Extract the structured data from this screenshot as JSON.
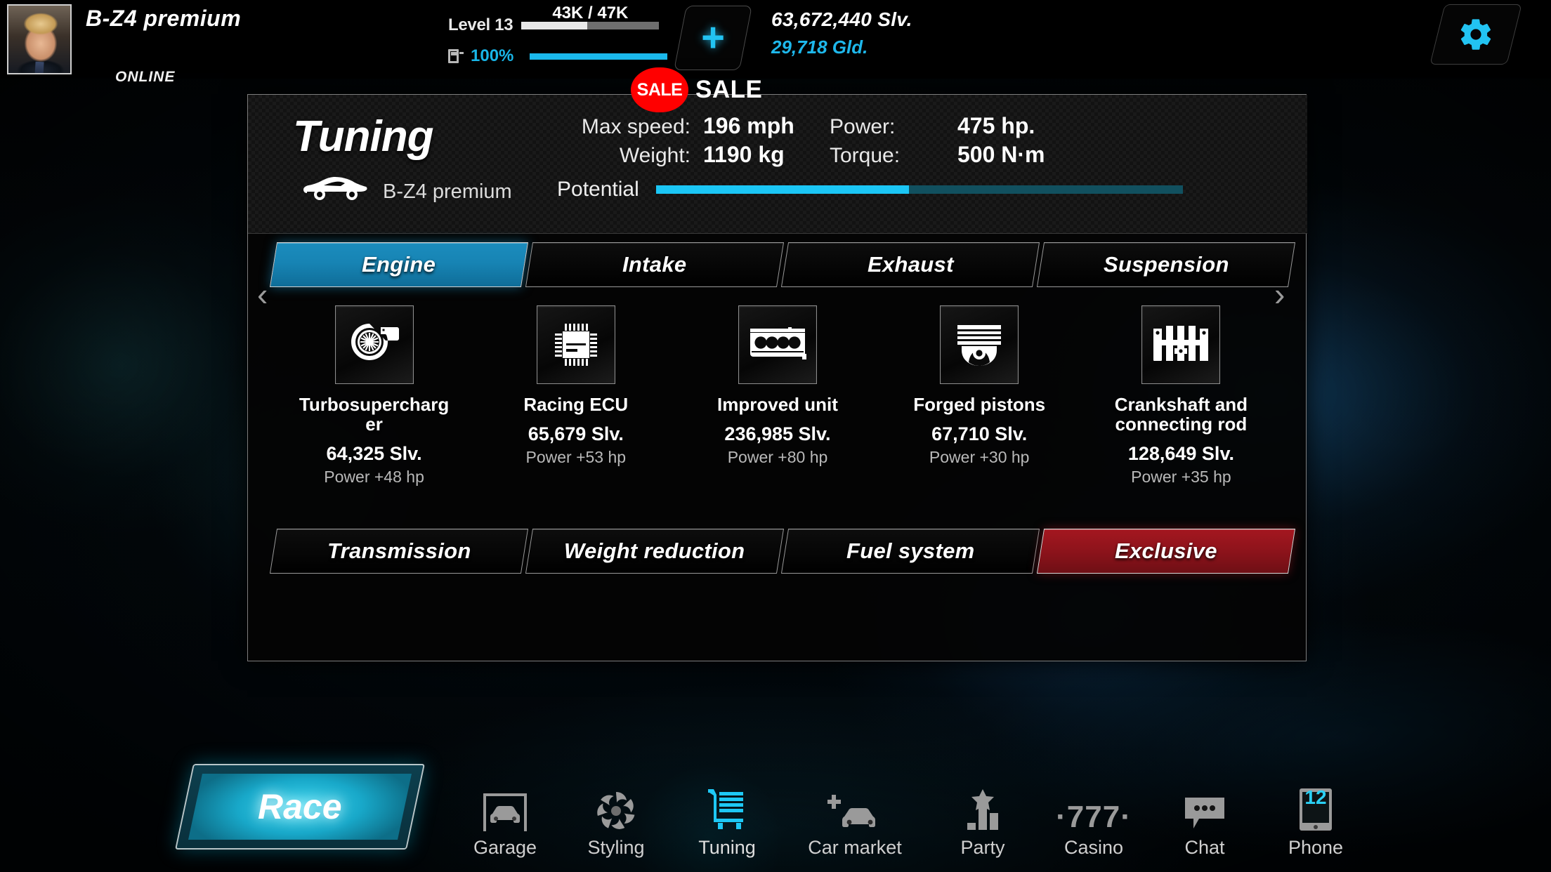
{
  "player": {
    "nickname": "B-Z4 premium",
    "status": "ONLINE",
    "avatar_icon": "player-portrait"
  },
  "status_bar": {
    "level_label": "Level 13",
    "xp_text": "43K / 47K",
    "xp_percent": 48,
    "fuel_icon": "fuel-pump-icon",
    "fuel_percent_label": "100%",
    "fuel_percent": 100,
    "add_button_icon": "plus-icon",
    "silver": "63,672,440 Slv.",
    "gold": "29,718 Gld.",
    "settings_icon": "gear-icon"
  },
  "sale": {
    "badge_label": "SALE",
    "text": "SALE",
    "badge_color": "#ff0000"
  },
  "panel": {
    "title": "Tuning",
    "car_icon": "car-silhouette-icon",
    "car_name": "B-Z4 premium",
    "stats": [
      {
        "label": "Max speed:",
        "value": "196 mph"
      },
      {
        "label": "Power:",
        "value": "475 hp."
      },
      {
        "label": "Weight:",
        "value": "1190 kg"
      },
      {
        "label": "Torque:",
        "value": "500 N·m"
      }
    ],
    "potential": {
      "label": "Potential",
      "percent": 48
    },
    "tabs_top": [
      {
        "label": "Engine",
        "state": "active"
      },
      {
        "label": "Intake",
        "state": "normal"
      },
      {
        "label": "Exhaust",
        "state": "normal"
      },
      {
        "label": "Suspension",
        "state": "normal"
      }
    ],
    "tabs_bottom": [
      {
        "label": "Transmission",
        "state": "normal"
      },
      {
        "label": "Weight reduction",
        "state": "normal"
      },
      {
        "label": "Fuel system",
        "state": "normal"
      },
      {
        "label": "Exclusive",
        "state": "exclusive"
      }
    ],
    "carousel": {
      "prev_icon": "chevron-left-icon",
      "next_icon": "chevron-right-icon"
    },
    "items": [
      {
        "icon": "turbocharger-icon",
        "name": "Turbosupercharger",
        "price": "64,325 Slv.",
        "bonus": "Power +48 hp"
      },
      {
        "icon": "ecu-chip-icon",
        "name": "Racing ECU",
        "price": "65,679 Slv.",
        "bonus": "Power +53 hp"
      },
      {
        "icon": "engine-block-icon",
        "name": "Improved unit",
        "price": "236,985 Slv.",
        "bonus": "Power +80 hp"
      },
      {
        "icon": "piston-icon",
        "name": "Forged pistons",
        "price": "67,710 Slv.",
        "bonus": "Power +30 hp"
      },
      {
        "icon": "crankshaft-icon",
        "name": "Crankshaft and connecting rod",
        "price": "128,649 Slv.",
        "bonus": "Power +35 hp"
      }
    ]
  },
  "bottom_nav": {
    "race_label": "Race",
    "items": [
      {
        "label": "Garage",
        "icon": "garage-icon",
        "state": "normal"
      },
      {
        "label": "Styling",
        "icon": "styling-fan-icon",
        "state": "normal"
      },
      {
        "label": "Tuning",
        "icon": "tuning-cart-icon",
        "state": "active"
      },
      {
        "label": "Car market",
        "icon": "car-market-icon",
        "state": "normal"
      },
      {
        "label": "Party",
        "icon": "party-chart-icon",
        "state": "normal"
      },
      {
        "label": "Casino",
        "icon": "casino-777-icon",
        "state": "normal",
        "glyph_text": "·777·"
      },
      {
        "label": "Chat",
        "icon": "chat-bubble-icon",
        "state": "normal"
      },
      {
        "label": "Phone",
        "icon": "phone-icon",
        "state": "normal",
        "badge": "12"
      }
    ]
  },
  "colors": {
    "accent_cyan": "#1bb9ec",
    "sale_red": "#ff0000",
    "exclusive_red": "#a41720",
    "tab_active_blue": "#1b8cbd"
  }
}
